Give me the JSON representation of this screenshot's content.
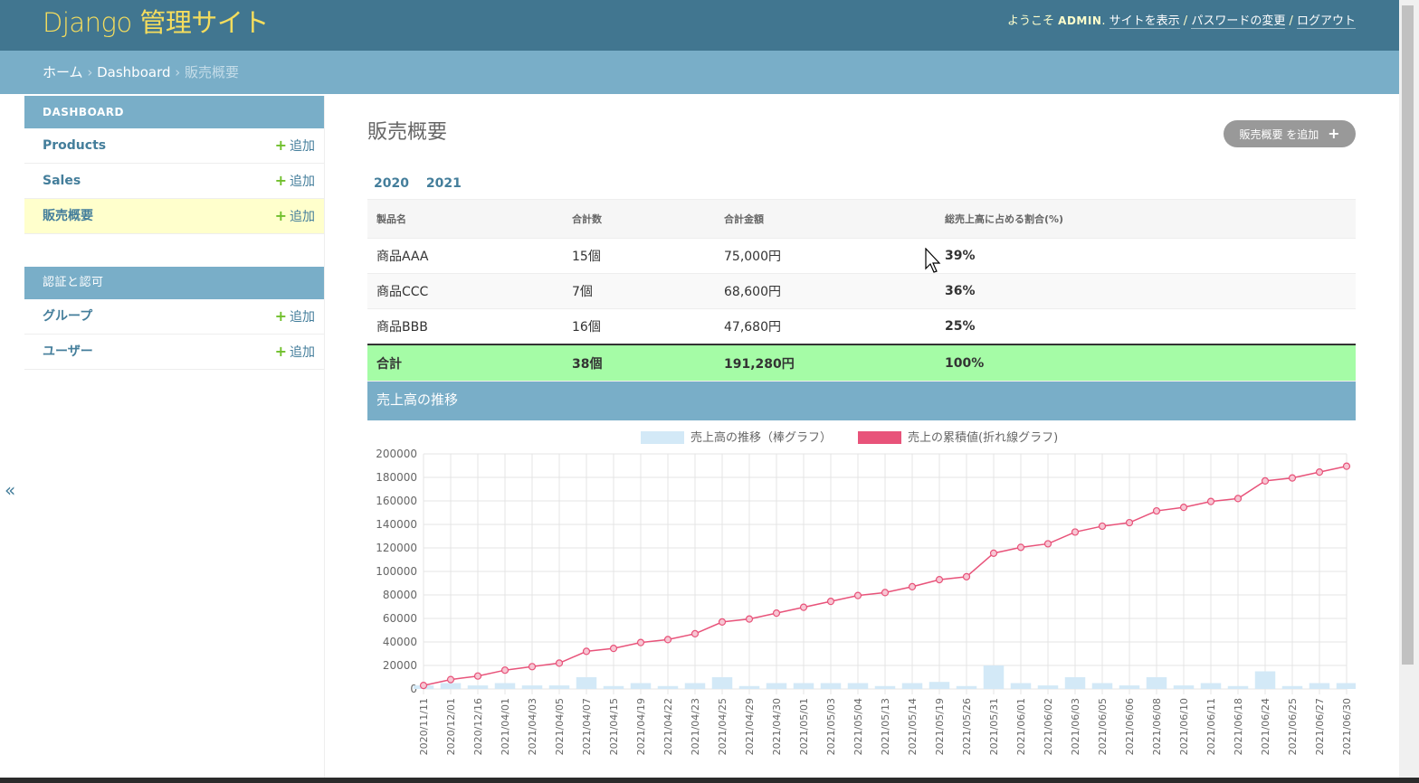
{
  "header": {
    "brand": "Django 管理サイト",
    "welcome": "ようこそ",
    "username": "ADMIN",
    "links": [
      "サイトを表示",
      "パスワードの変更",
      "ログアウト"
    ]
  },
  "breadcrumbs": {
    "home": "ホーム",
    "app": "Dashboard",
    "current": "販売概要"
  },
  "sidebar": {
    "modules": [
      {
        "caption": "DASHBOARD",
        "items": [
          {
            "label": "Products",
            "add": "追加"
          },
          {
            "label": "Sales",
            "add": "追加"
          },
          {
            "label": "販売概要",
            "add": "追加",
            "selected": true
          }
        ]
      },
      {
        "caption": "認証と認可",
        "items": [
          {
            "label": "グループ",
            "add": "追加"
          },
          {
            "label": "ユーザー",
            "add": "追加"
          }
        ]
      }
    ],
    "toggle": "«"
  },
  "content": {
    "title": "販売概要",
    "add_button": "販売概要 を追加",
    "years": [
      "2020",
      "2021"
    ],
    "table": {
      "headers": [
        "製品名",
        "合計数",
        "合計金額",
        "総売上高に占める割合(%)"
      ],
      "rows": [
        [
          "商品AAA",
          "15個",
          "75,000円",
          "39%"
        ],
        [
          "商品CCC",
          "7個",
          "68,600円",
          "36%"
        ],
        [
          "商品BBB",
          "16個",
          "47,680円",
          "25%"
        ]
      ],
      "total": [
        "合計",
        "38個",
        "191,280円",
        "100%"
      ]
    },
    "section_title": "売上高の推移"
  },
  "colors": {
    "header": "#417690",
    "breadcrumbs": "#79aec8",
    "brand": "#f5dd5d",
    "total_row": "#a5fca6",
    "bar": "#d3e9f7",
    "line": "#e8537a"
  },
  "chart_data": {
    "type": "bar",
    "legend_position": "top",
    "grid": true,
    "ylim": [
      0,
      200000
    ],
    "yticks": [
      0,
      20000,
      40000,
      60000,
      80000,
      100000,
      120000,
      140000,
      160000,
      180000,
      200000
    ],
    "categories": [
      "2020/11/11",
      "2020/12/01",
      "2020/12/16",
      "2021/04/01",
      "2021/04/03",
      "2021/04/05",
      "2021/04/07",
      "2021/04/15",
      "2021/04/19",
      "2021/04/22",
      "2021/04/23",
      "2021/04/25",
      "2021/04/29",
      "2021/04/30",
      "2021/05/01",
      "2021/05/03",
      "2021/05/04",
      "2021/05/13",
      "2021/05/14",
      "2021/05/19",
      "2021/05/26",
      "2021/05/31",
      "2021/06/01",
      "2021/06/02",
      "2021/06/03",
      "2021/06/05",
      "2021/06/06",
      "2021/06/08",
      "2021/06/10",
      "2021/06/11",
      "2021/06/18",
      "2021/06/24",
      "2021/06/25",
      "2021/06/27",
      "2021/06/30"
    ],
    "series": [
      {
        "name": "売上高の推移（棒グラフ）",
        "type": "bar",
        "values": [
          3000,
          5000,
          3000,
          5000,
          3000,
          3000,
          10000,
          2500,
          5000,
          2500,
          5000,
          10000,
          2500,
          5000,
          5000,
          5000,
          5000,
          2500,
          5000,
          6000,
          2500,
          20000,
          5000,
          3000,
          10000,
          5000,
          3000,
          10000,
          3000,
          5000,
          2500,
          15000,
          2500,
          5000,
          5000
        ]
      },
      {
        "name": "売上の累積値(折れ線グラフ)",
        "type": "line",
        "values": [
          3000,
          8000,
          11000,
          16000,
          19000,
          22000,
          32000,
          34500,
          39500,
          42000,
          47000,
          57000,
          59500,
          64500,
          69500,
          74500,
          79500,
          82000,
          87000,
          93000,
          95500,
          115500,
          120500,
          123500,
          133500,
          138500,
          141500,
          151500,
          154500,
          159500,
          162000,
          177000,
          179500,
          184500,
          189500
        ]
      }
    ]
  }
}
